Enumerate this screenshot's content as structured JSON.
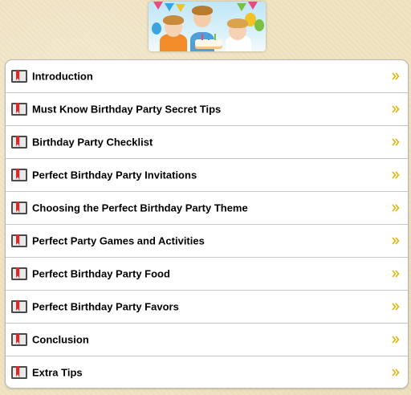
{
  "header": {
    "banner_icon": "birthday-kids-image"
  },
  "menu": {
    "items": [
      {
        "label": "Introduction",
        "icon": "book-icon",
        "arrow": "chevron-right-icon"
      },
      {
        "label": "Must Know Birthday Party Secret Tips",
        "icon": "book-icon",
        "arrow": "chevron-right-icon"
      },
      {
        "label": "Birthday Party Checklist",
        "icon": "book-icon",
        "arrow": "chevron-right-icon"
      },
      {
        "label": "Perfect Birthday Party Invitations",
        "icon": "book-icon",
        "arrow": "chevron-right-icon"
      },
      {
        "label": "Choosing the Perfect Birthday Party Theme",
        "icon": "book-icon",
        "arrow": "chevron-right-icon"
      },
      {
        "label": "Perfect Party Games and Activities",
        "icon": "book-icon",
        "arrow": "chevron-right-icon"
      },
      {
        "label": "Perfect Birthday Party Food",
        "icon": "book-icon",
        "arrow": "chevron-right-icon"
      },
      {
        "label": "Perfect Birthday Party Favors",
        "icon": "book-icon",
        "arrow": "chevron-right-icon"
      },
      {
        "label": "Conclusion",
        "icon": "book-icon",
        "arrow": "chevron-right-icon"
      },
      {
        "label": "Extra Tips",
        "icon": "book-icon",
        "arrow": "chevron-right-icon"
      }
    ]
  },
  "colors": {
    "background": "#efe3c1",
    "list_background": "#ffffff",
    "separator": "#c8c8c8",
    "book_cover": "#4a4a4a",
    "bookmark": "#d62b2b",
    "chevron": "#e0b400",
    "text": "#000000"
  }
}
